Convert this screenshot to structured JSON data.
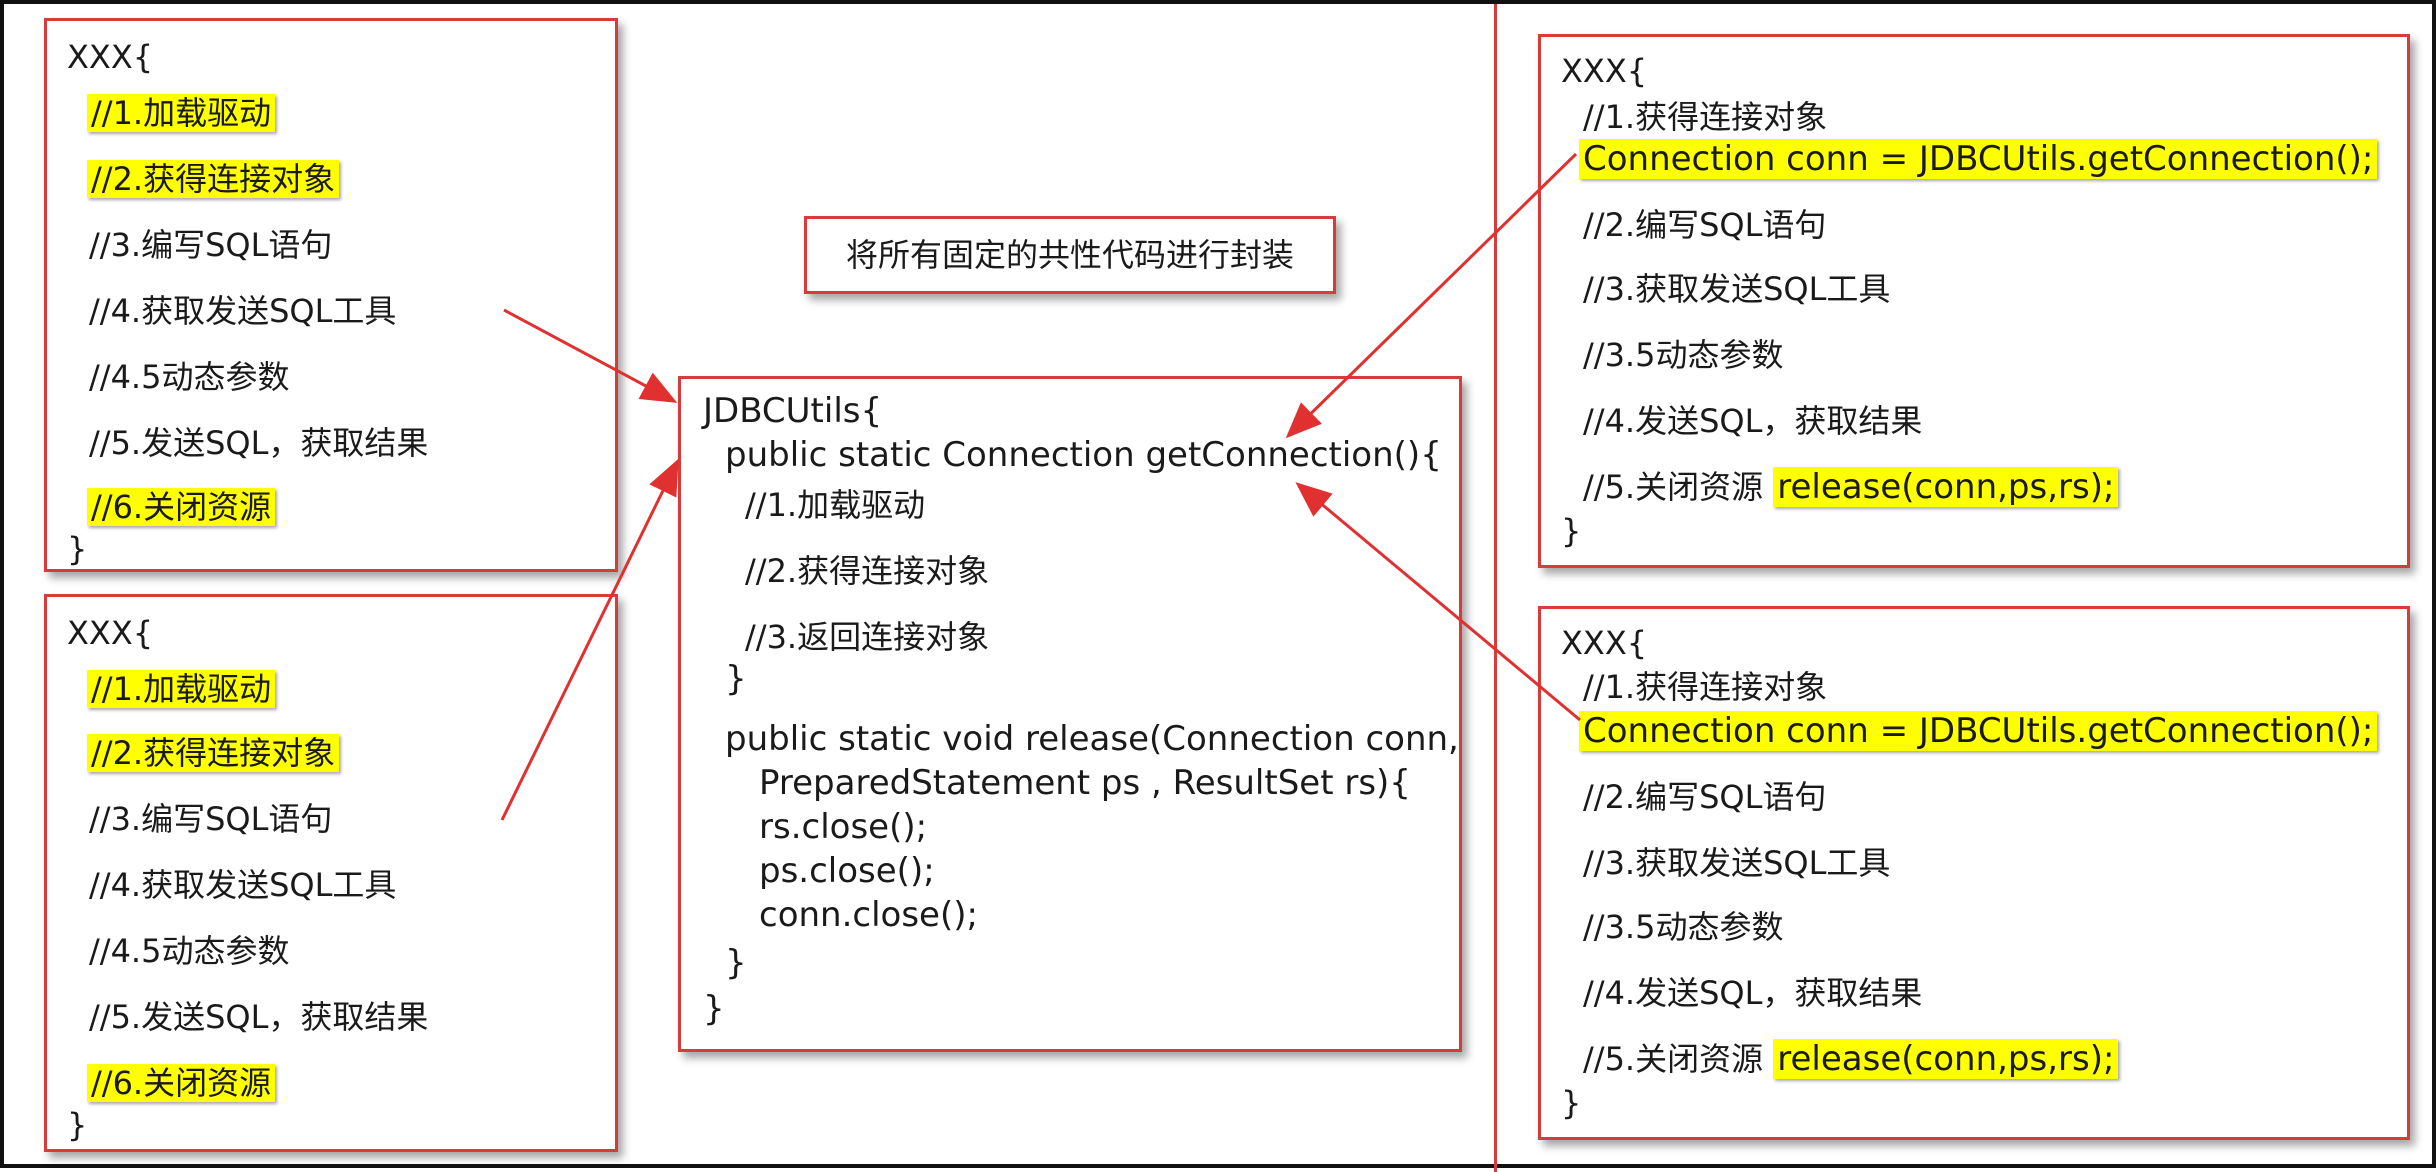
{
  "left_top": {
    "lines": [
      "XXX{",
      "//1.加载驱动",
      "//2.获得连接对象",
      "//3.编写SQL语句",
      "//4.获取发送SQL工具",
      "//4.5动态参数",
      "//5.发送SQL，获取结果",
      "//6.关闭资源",
      "}"
    ]
  },
  "left_bottom": {
    "lines": [
      "XXX{",
      "//1.加载驱动",
      "//2.获得连接对象",
      "//3.编写SQL语句",
      "//4.获取发送SQL工具",
      "//4.5动态参数",
      "//5.发送SQL，获取结果",
      "//6.关闭资源",
      "}"
    ]
  },
  "note": "将所有固定的共性代码进行封装",
  "center": {
    "lines": [
      "JDBCUtils{",
      "public static Connection getConnection(){",
      "//1.加载驱动",
      "//2.获得连接对象",
      "//3.返回连接对象",
      "}",
      "public static void release(Connection conn,",
      "PreparedStatement ps , ResultSet rs){",
      "rs.close();",
      "ps.close();",
      "conn.close();",
      "}",
      "}"
    ]
  },
  "right_top": {
    "lines": [
      "XXX{",
      "//1.获得连接对象",
      "Connection conn = JDBCUtils.getConnection();",
      "//2.编写SQL语句",
      "//3.获取发送SQL工具",
      "//3.5动态参数",
      "//4.发送SQL，获取结果",
      "//5.关闭资源",
      "release(conn,ps,rs);",
      "}"
    ]
  },
  "right_bottom": {
    "lines": [
      "XXX{",
      "//1.获得连接对象",
      "Connection conn = JDBCUtils.getConnection();",
      "//2.编写SQL语句",
      "//3.获取发送SQL工具",
      "//3.5动态参数",
      "//4.发送SQL，获取结果",
      "//5.关闭资源",
      "release(conn,ps,rs);",
      "}"
    ]
  },
  "colors": {
    "border": "#d93a3a",
    "arrow": "#e03030",
    "highlight": "#ffff00"
  }
}
